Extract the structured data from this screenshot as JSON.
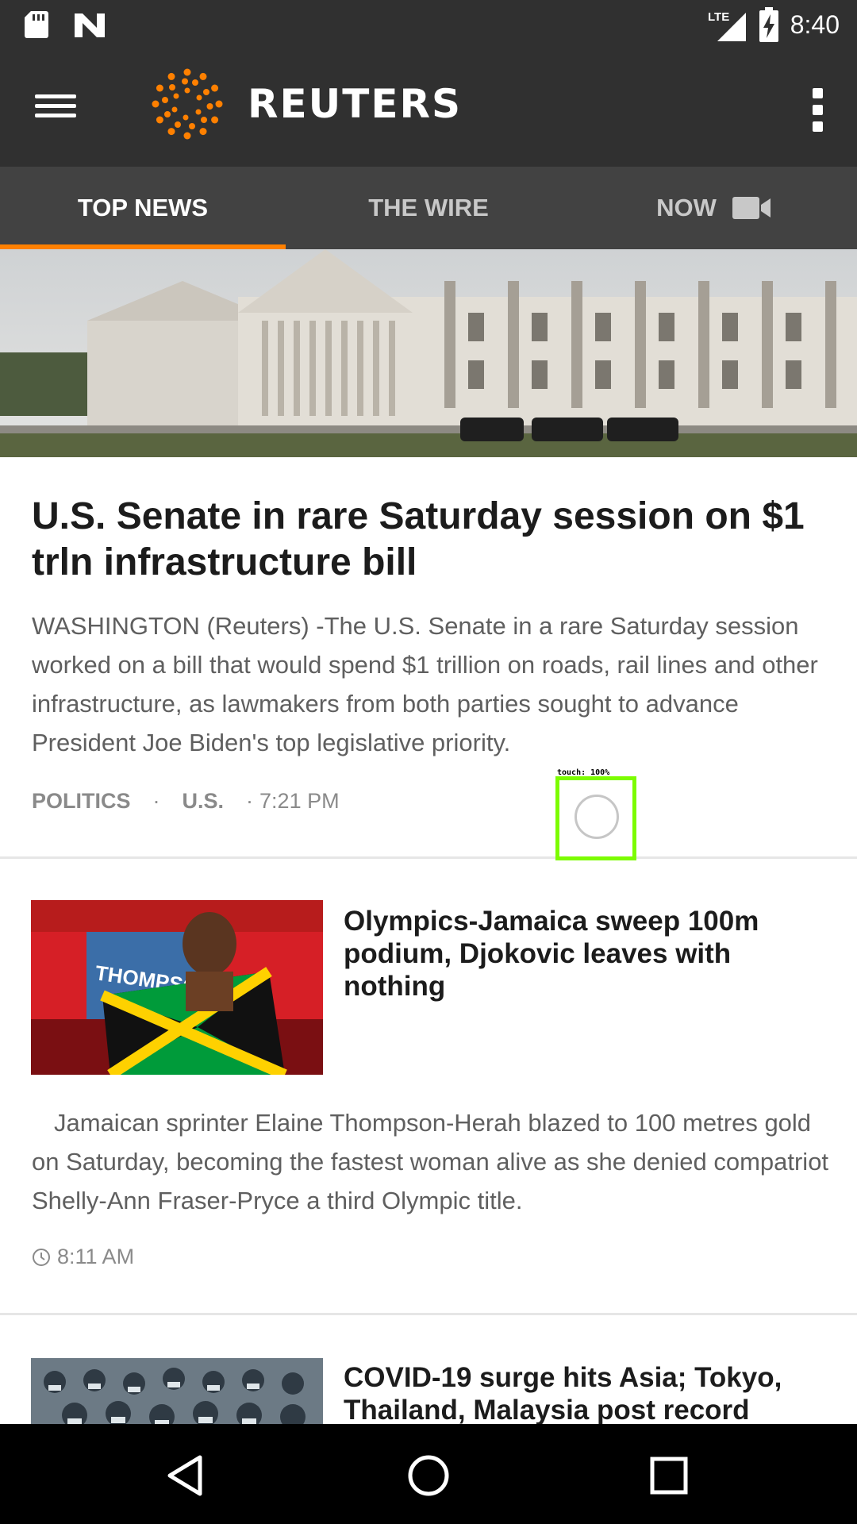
{
  "status_bar": {
    "time": "8:40",
    "network": "LTE",
    "icons": [
      "sd-card-icon",
      "n-notification-icon",
      "signal-icon",
      "battery-charging-icon"
    ]
  },
  "app_bar": {
    "brand": "REUTERS",
    "menu_icon": "hamburger-menu-icon",
    "overflow_icon": "more-vert-icon"
  },
  "tabs": [
    {
      "label": "TOP NEWS",
      "active": true
    },
    {
      "label": "THE WIRE",
      "active": false
    },
    {
      "label": "NOW",
      "active": false,
      "icon": "video-camera-icon"
    }
  ],
  "accent_color": "#ff8000",
  "touch_indicator": {
    "label": "touch: 100%"
  },
  "stories": [
    {
      "headline": "U.S. Senate in rare Saturday session on $1 trln infrastructure bill",
      "summary": "WASHINGTON (Reuters) -The U.S. Senate in a rare Saturday session worked on a bill that would spend $1 trillion on roads, rail lines and other infrastructure, as lawmakers from both parties sought to advance President Joe Biden's top legislative priority.",
      "categories": [
        "POLITICS",
        "U.S."
      ],
      "time": "7:21 PM",
      "image": "capitol-building-photo"
    },
    {
      "headline": "Olympics-Jamaica sweep 100m podium, Djokovic leaves with nothing",
      "summary": "Jamaican sprinter Elaine Thompson-Herah blazed to 100 metres gold on Saturday, becoming the fastest woman alive as she denied compatriot Shelly-Ann Fraser-Pryce a third Olympic title.",
      "time": "8:11 AM",
      "image": "sprinter-with-jamaican-flag-photo"
    },
    {
      "headline": "COVID-19 surge hits Asia; Tokyo, Thailand, Malaysia post record",
      "image": "crowd-in-masks-photo"
    }
  ],
  "nav_bar": {
    "back": "back-icon",
    "home": "home-icon",
    "recents": "recents-icon"
  }
}
